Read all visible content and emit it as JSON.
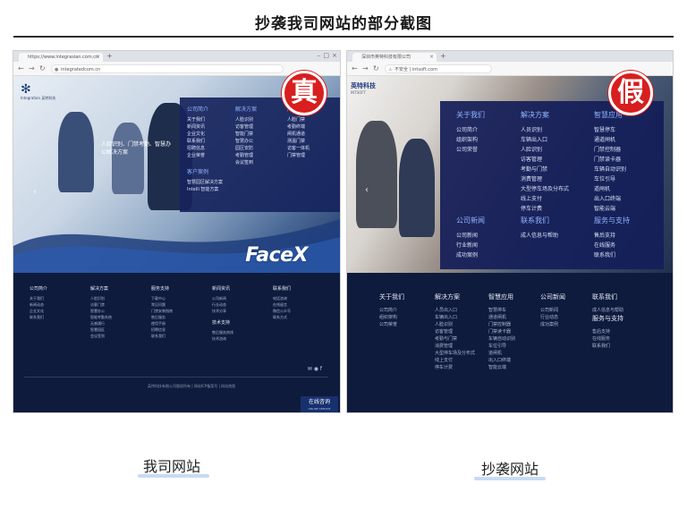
{
  "title": "抄袭我司网站的部分截图",
  "left": {
    "stamp": "真",
    "tab_title": "https://www.integrasian.com.cn",
    "url": "integratedcom.cn",
    "logo_text": "Integration 英特科技",
    "hero_caption": "人脸识别、门禁考勤、智慧办公解决方案",
    "hero_brand": "FaceX",
    "dropdown": [
      {
        "head": "公司简介",
        "items": [
          "关于我们",
          "新闻资讯",
          "企业文化",
          "联系我们",
          "招聘信息",
          "企业荣誉"
        ]
      },
      {
        "head": "解决方案",
        "items": [
          "人脸识别",
          "访客管理",
          "智能门禁",
          "智慧办公",
          "园区安防",
          "考勤管理",
          "会议签到"
        ]
      },
      {
        "head": "产品中心",
        "items": [
          "人脸门禁",
          "考勤终端",
          "闸机通道",
          "测温门禁",
          "访客一体机",
          "门禁管理"
        ]
      }
    ],
    "dropdown_extra": {
      "head": "客户案例",
      "items": [
        "智慧园区解决方案",
        "Intelli 智能方案"
      ]
    },
    "footer": [
      {
        "head": "公司简介",
        "items": [
          "关于我们",
          "新闻动态",
          "企业文化",
          "联系我们"
        ]
      },
      {
        "head": "解决方案",
        "items": [
          "人脸识别",
          "访客门禁",
          "智慧办公",
          "智能考勤系统",
          "无感通行",
          "智慧园区",
          "会议签到"
        ]
      },
      {
        "head": "服务支持",
        "items": [
          "下载中心",
          "常见问题",
          "门禁安装指南",
          "售后服务",
          "使用手册",
          "招聘信息",
          "联系我们"
        ]
      },
      {
        "head": "新闻资讯",
        "items": [
          "公司新闻",
          "行业动态",
          "技术分享"
        ]
      },
      {
        "head": "联系我们",
        "items": [
          "电话咨询",
          "在线留言",
          "微信公众号",
          "联系方式"
        ]
      }
    ],
    "footer_extra": {
      "head": "技术支持",
      "items": [
        "售后服务热线",
        "技术咨询"
      ]
    },
    "copyright": "英特科技有限公司版权所有 | 网站ICP备案号 | 网站地图",
    "online_btn": "在线咨询",
    "online_btn_sub": "ONLINE SERVICE"
  },
  "right": {
    "stamp": "假",
    "tab_title": "深圳市英特科技有限公司",
    "url": "不安全 | intsoft.com",
    "logo_text": "英特科技",
    "logo_sub": "INTSOFT",
    "dropdown": [
      {
        "head": "关于我们",
        "items": [
          "公司简介",
          "组织架构",
          "公司荣誉"
        ]
      },
      {
        "head": "解决方案",
        "items": [
          "人员识别",
          "车辆出入口",
          "人脸识别",
          "访客管理",
          "考勤与门禁",
          "消费管理",
          "大型停车场及分布式",
          "线上支付",
          "停车计费"
        ]
      },
      {
        "head": "智慧应用",
        "items": [
          "智慧停车",
          "通道闸机",
          "门禁控制器",
          "门禁读卡器",
          "车辆自动识别",
          "车位引导",
          "道闸机",
          "出入口终端",
          "智能云端"
        ]
      },
      {
        "head": "公司新闻",
        "items": [
          "公司新闻",
          "行业新闻",
          "成功案例"
        ]
      },
      {
        "head": "联系我们",
        "items": [
          "成人信息与帮助"
        ]
      },
      {
        "head": "服务与支持",
        "items": [
          "售后支持",
          "在线服务",
          "联系我们"
        ]
      }
    ],
    "footer": [
      {
        "head": "关于我们",
        "items": [
          "公司简介",
          "组织架构",
          "公司荣誉"
        ]
      },
      {
        "head": "解决方案",
        "items": [
          "人员出入口",
          "车辆出入口",
          "人脸识别",
          "访客管理",
          "考勤与门禁",
          "消费管理",
          "大型停车场及分布式",
          "线上支付",
          "停车计费"
        ]
      },
      {
        "head": "智慧应用",
        "items": [
          "智慧停车",
          "通道闸机",
          "门禁控制器",
          "门禁读卡器",
          "车辆自动识别",
          "车位引导",
          "道闸机",
          "出入口终端",
          "智能云端"
        ]
      },
      {
        "head": "公司新闻",
        "items": [
          "公司新闻",
          "行业动态",
          "成功案例"
        ]
      },
      {
        "head": "联系我们",
        "items": [
          "成人信息与帮助"
        ]
      }
    ],
    "footer_extra": {
      "head": "服务与支持",
      "items": [
        "售后支持",
        "在线服务",
        "联系我们"
      ]
    }
  },
  "captions": {
    "left": "我司网站",
    "right": "抄袭网站"
  }
}
